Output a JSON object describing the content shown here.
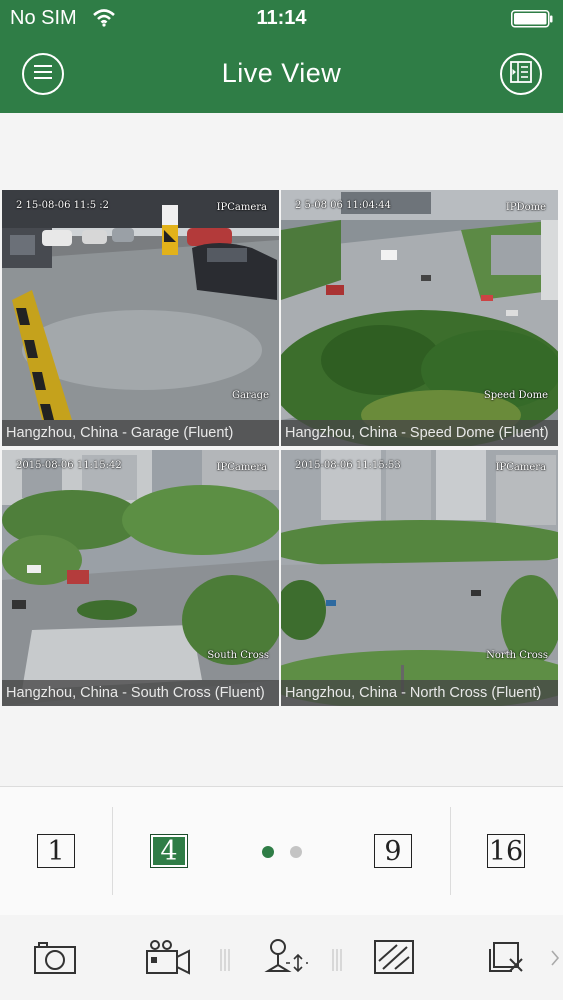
{
  "status_bar": {
    "carrier": "No SIM",
    "time": "11:14"
  },
  "header": {
    "title": "Live View",
    "left_icon": "menu-icon",
    "right_icon": "layout-list-icon",
    "bg_color": "#2f7d46"
  },
  "cameras": [
    {
      "caption": "Hangzhou, China - Garage (Fluent)",
      "osd_time": "2 15-08-06 11:5 :2",
      "osd_cam": "IPCamera",
      "osd_name": "Garage",
      "selected": false
    },
    {
      "caption": "Hangzhou, China - Speed Dome (Fluent)",
      "osd_time": "2 5-08  06 11:04:44",
      "osd_cam": "IPDome",
      "osd_name": "Speed Dome",
      "selected": true
    },
    {
      "caption": "Hangzhou, China - South Cross (Fluent)",
      "osd_time": "2015-08-06 11:15:42",
      "osd_cam": "IPCamera",
      "osd_name": "South Cross",
      "selected": false
    },
    {
      "caption": "Hangzhou, China - North Cross (Fluent)",
      "osd_time": "2015-08-06 11:15:53",
      "osd_cam": "IPCamera",
      "osd_name": "North Cross",
      "selected": false
    }
  ],
  "split_options": {
    "one": "1",
    "four": "4",
    "nine": "9",
    "sixteen": "16",
    "active": "4",
    "page_count": 2,
    "current_page": 1
  },
  "toolbar": {
    "icons": [
      "camera-snapshot-icon",
      "video-record-icon",
      "ptz-control-icon",
      "image-quality-icon",
      "close-all-icon",
      "more-chevron-icon"
    ]
  },
  "colors": {
    "accent": "#2f7d46",
    "selected_border": "#e5b124",
    "dot_active": "#2f7d46",
    "dot_inactive": "#c4c4c4"
  }
}
